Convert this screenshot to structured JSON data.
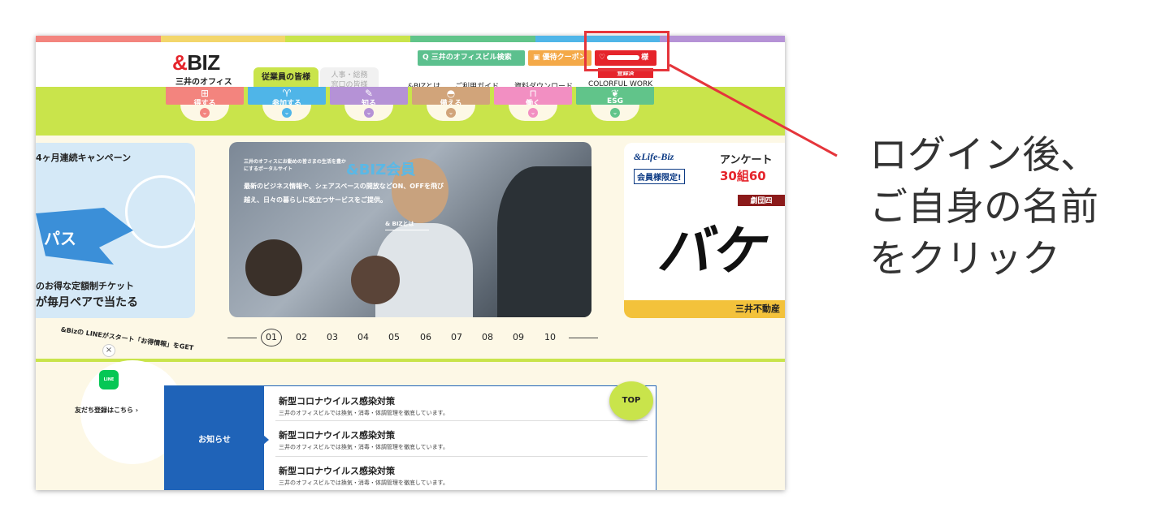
{
  "header": {
    "logo": "&BIZ",
    "logo_sub": "三井のオフィス",
    "tab_employee": "従業員の皆様",
    "tab_hr_line1": "人事・総務",
    "tab_hr_line2": "窓口の皆様",
    "search_button": "Q 三井のオフィスビル検索",
    "coupon_button": "優待クーポン",
    "user_button_suffix": "様",
    "registered_badge": "登録済",
    "nav": [
      "&BIZとは",
      "ご利用ガイド",
      "資料ダウンロード",
      "COLORFUL WORK"
    ]
  },
  "categories": [
    {
      "label": "得する",
      "icon": "gift-icon",
      "color": "#f3847e"
    },
    {
      "label": "参加する",
      "icon": "trophy-icon",
      "color": "#4fb5e8"
    },
    {
      "label": "知る",
      "icon": "note-icon",
      "color": "#b592d6"
    },
    {
      "label": "備える",
      "icon": "helmet-icon",
      "color": "#d1a47a"
    },
    {
      "label": "働く",
      "icon": "bag-icon",
      "color": "#f28fc2"
    },
    {
      "label": "ESG",
      "icon": "leaf-icon",
      "color": "#61c48a"
    }
  ],
  "slides": {
    "left_top": "4ヶ月連続キャンペーン",
    "left_mid1": "のお得な定額制チケット",
    "left_mid2": "が毎月ペアで当たる",
    "left_star": "パス",
    "main_small": "三井のオフィスにお勤めの皆さまの生活を豊かにするポータルサイト",
    "main_big": "&BIZ会員",
    "main_desc": "最新のビジネス情報や、シェアスペースの開放などON、OFFを飛び越え、日々の暮らしに役立つサービスをご提供。",
    "main_link": "& BIZとは",
    "right_brand": "&Life-Biz",
    "right_member": "会員様限定!",
    "right_survey": "アンケート",
    "right_prize": "30組60",
    "right_theater": "劇団四",
    "right_kanji": "バケ",
    "right_footer": "三井不動産"
  },
  "pager": {
    "pages": [
      "01",
      "02",
      "03",
      "04",
      "05",
      "06",
      "07",
      "08",
      "09",
      "10"
    ],
    "active": "01"
  },
  "line_widget": {
    "arc_text": "&Bizの LINEがスタート「お得情報」をGET",
    "close": "×",
    "icon_label": "LINE",
    "cta": "友だち登録はこちら ›"
  },
  "news": {
    "label": "お知らせ",
    "items": [
      {
        "title": "新型コロナウイルス感染対策",
        "sub": "三井のオフィスビルでは換気・消毒・体調管理を徹底しています。"
      },
      {
        "title": "新型コロナウイルス感染対策",
        "sub": "三井のオフィスビルでは換気・消毒・体調管理を徹底しています。"
      },
      {
        "title": "新型コロナウイルス感染対策",
        "sub": "三井のオフィスビルでは換気・消毒・体調管理を徹底しています。"
      }
    ]
  },
  "top_button": "TOP",
  "callout": {
    "line1": "ログイン後、",
    "line2": "ご自身の名前",
    "line3": "をクリック"
  },
  "colors": {
    "accent_green": "#c9e44b",
    "brand_red": "#e5242b",
    "news_blue": "#1f63b8",
    "highlight_red": "#e5353b"
  }
}
